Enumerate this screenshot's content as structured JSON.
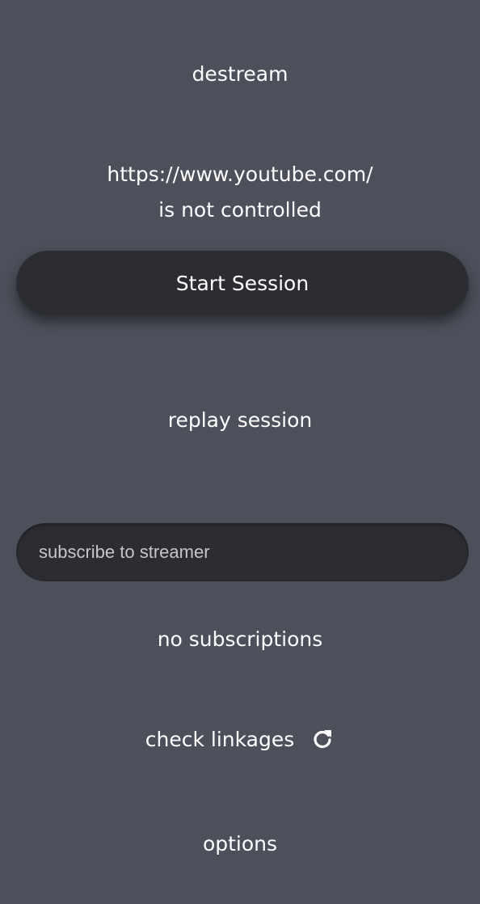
{
  "app": {
    "title": "destream"
  },
  "status": {
    "url": "https://www.youtube.com/",
    "message": "is not controlled"
  },
  "actions": {
    "start_session_label": "Start Session",
    "replay_session_label": "replay session"
  },
  "subscribe": {
    "placeholder": "subscribe to streamer",
    "value": ""
  },
  "subscriptions": {
    "empty_text": "no subscriptions"
  },
  "linkages": {
    "label": "check linkages",
    "icon": "refresh-icon"
  },
  "options": {
    "label": "options"
  }
}
